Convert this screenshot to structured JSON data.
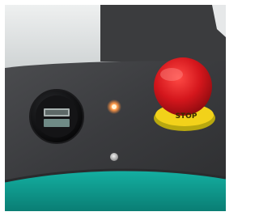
{
  "scene": {
    "stop_button": {
      "label": "STOP",
      "cap_color": "#d4161c",
      "collar_color": "#f2d21a"
    },
    "hour_meter": {
      "bezel_color": "#0e0e10",
      "display_color": "#6f8a86"
    },
    "indicators": {
      "amber_led_color": "#ff8a3a",
      "white_led_color": "#dcdcdc"
    },
    "panel_color": "#3c3d3f",
    "base_color": "#0f9a8d"
  }
}
